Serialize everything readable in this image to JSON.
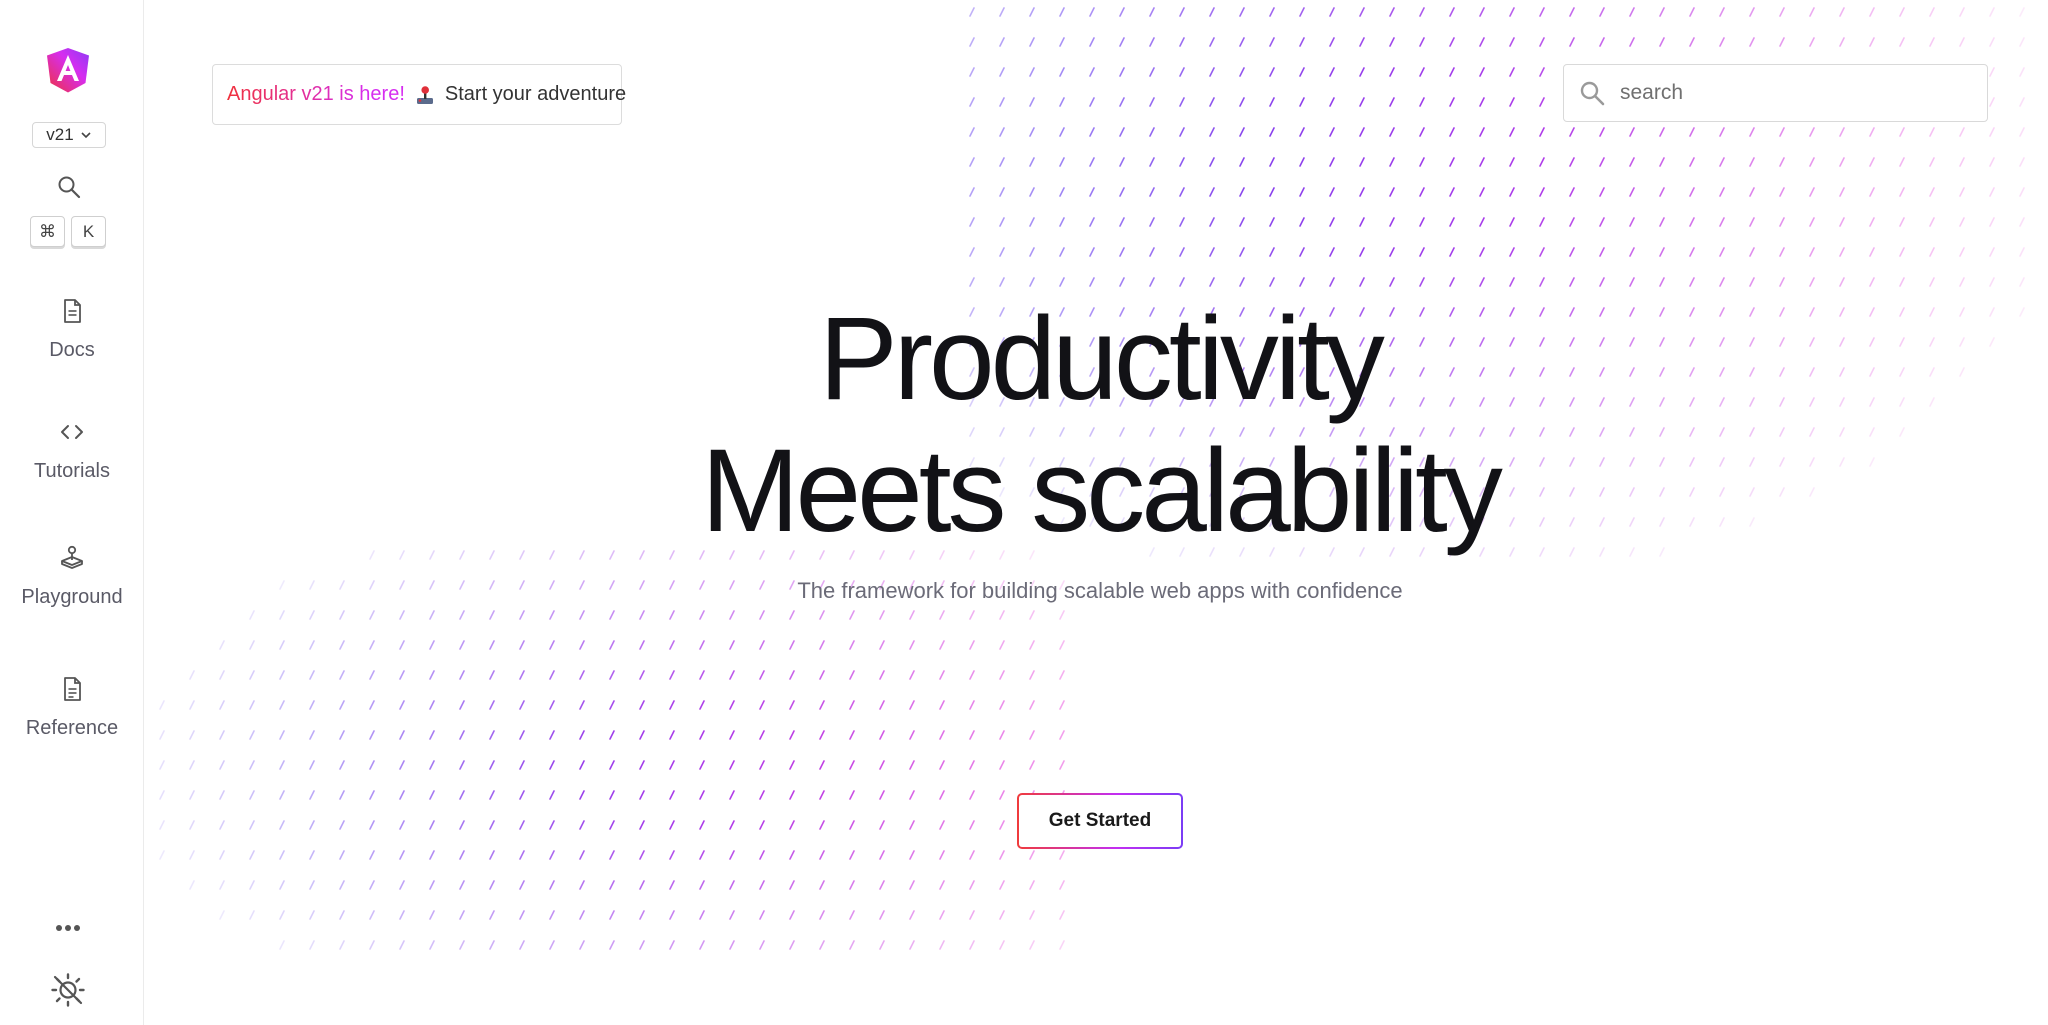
{
  "sidebar": {
    "version": "v21",
    "shortcut_keys": [
      "⌘",
      "K"
    ],
    "items": [
      {
        "label": "Docs",
        "icon": "document-icon"
      },
      {
        "label": "Tutorials",
        "icon": "code-icon"
      },
      {
        "label": "Playground",
        "icon": "joystick-icon"
      },
      {
        "label": "Reference",
        "icon": "reference-icon"
      }
    ]
  },
  "announcement": {
    "highlight": "Angular v21 is here!",
    "emoji": "🕹️",
    "text": "Start your adventure"
  },
  "search": {
    "placeholder": "search"
  },
  "hero": {
    "line1": "Productivity",
    "line2": "Meets scalability",
    "tagline": "The framework for building scalable web apps with confidence",
    "cta_label": "Get Started"
  },
  "colors": {
    "brand_red": "#f0313b",
    "brand_pink": "#d62df0",
    "brand_purple": "#7a3cf5",
    "text_dark": "#121216",
    "text_muted": "#6b6b78"
  }
}
